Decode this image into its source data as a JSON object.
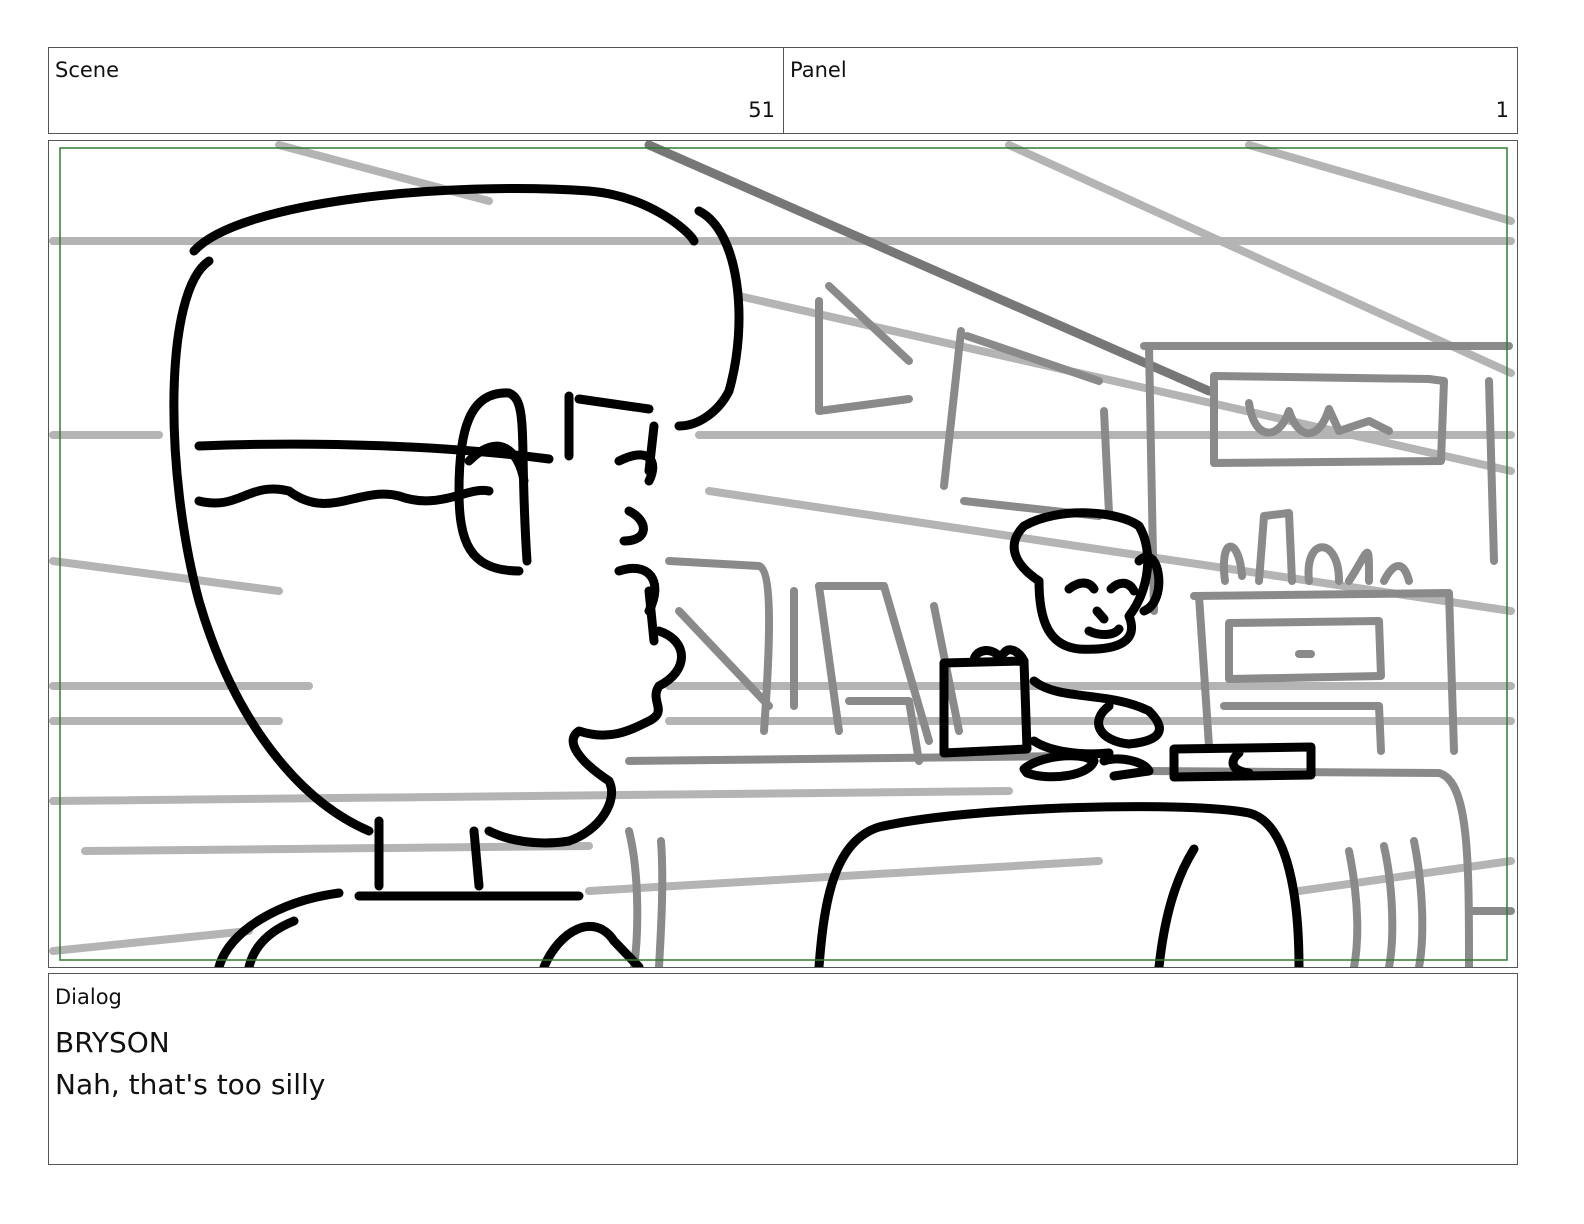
{
  "header": {
    "scene_label": "Scene",
    "scene_value": "51",
    "panel_label": "Panel",
    "panel_value": "1"
  },
  "frame": {
    "safe_area_color": "#2e7d32",
    "sketch_background_color": "#8a8a8a",
    "sketch_foreground_color": "#000000"
  },
  "dialog": {
    "label": "Dialog",
    "character": "BRYSON",
    "line": "Nah, that's too silly"
  }
}
